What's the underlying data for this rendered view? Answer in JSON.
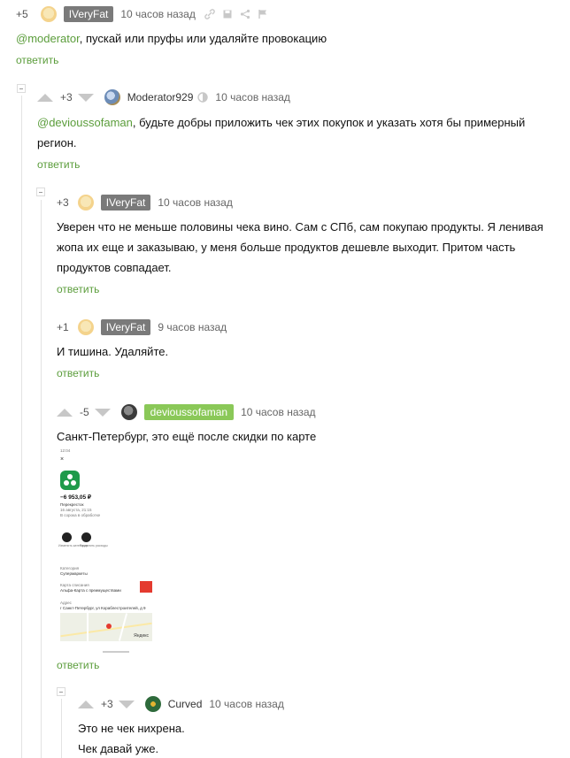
{
  "comments": [
    {
      "rating": "+5",
      "author": "IVeryFat",
      "time": "10 часов назад",
      "mention": "@moderator",
      "text": ",  пускай или пруфы или удаляйте провокацию",
      "reply": "ответить"
    },
    {
      "rating": "+3",
      "author": "Moderator929",
      "time": "10 часов назад",
      "mention": "@devioussofaman",
      "text": ", будьте добры приложить чек этих покупок и указать хотя бы примерный",
      "text_line2": "регион.",
      "reply": "ответить"
    },
    {
      "rating": "+3",
      "author": "IVeryFat",
      "time": "10 часов назад",
      "lines": [
        "Уверен что не меньше половины чека вино. Сам с СПб, сам покупаю продукты. Я ленивая",
        "жопа их еще и заказываю, у меня больше продуктов дешевле выходит. Притом часть",
        "продуктов совпадает."
      ],
      "reply": "ответить"
    },
    {
      "rating": "+1",
      "author": "IVeryFat",
      "time": "9 часов назад",
      "text": "И тишина. Удаляйте.",
      "reply": "ответить"
    },
    {
      "rating": "-5",
      "author": "devioussofaman",
      "time": "10 часов назад",
      "text": "Санкт-Петербург, это ещё после скидки по карте",
      "reply": "ответить",
      "receipt": {
        "status_time": "12:04",
        "close": "×",
        "amount": "−6 953,05 ₽",
        "merchant": "Перекресток",
        "date": "16 августа, 21:15",
        "note": "В сорока в обработке",
        "action1": "Изменить категорию",
        "action2": "Разделить расходы",
        "category_label": "Категория",
        "category": "Супермаркеты",
        "card_label": "Карта списания",
        "card": "Альфа-Карта с преимуществами",
        "address_label": "Адрес",
        "address": "г Санкт-Петербург, ул Кораблестроителей, д 9",
        "map_brand": "Яндекс"
      }
    },
    {
      "rating": "+3",
      "author": "Curved",
      "time": "10 часов назад",
      "lines": [
        "Это не чек нихрена.",
        "Чек давай уже."
      ]
    }
  ],
  "colors": {
    "accent_green": "#5b9d3b",
    "badge_green": "#8ac858",
    "badge_gray": "#7a7a7a"
  },
  "icons": [
    "link-icon",
    "save-icon",
    "share-icon",
    "flag-icon",
    "moderator-badge-icon",
    "arrow-up-icon",
    "arrow-down-icon"
  ]
}
